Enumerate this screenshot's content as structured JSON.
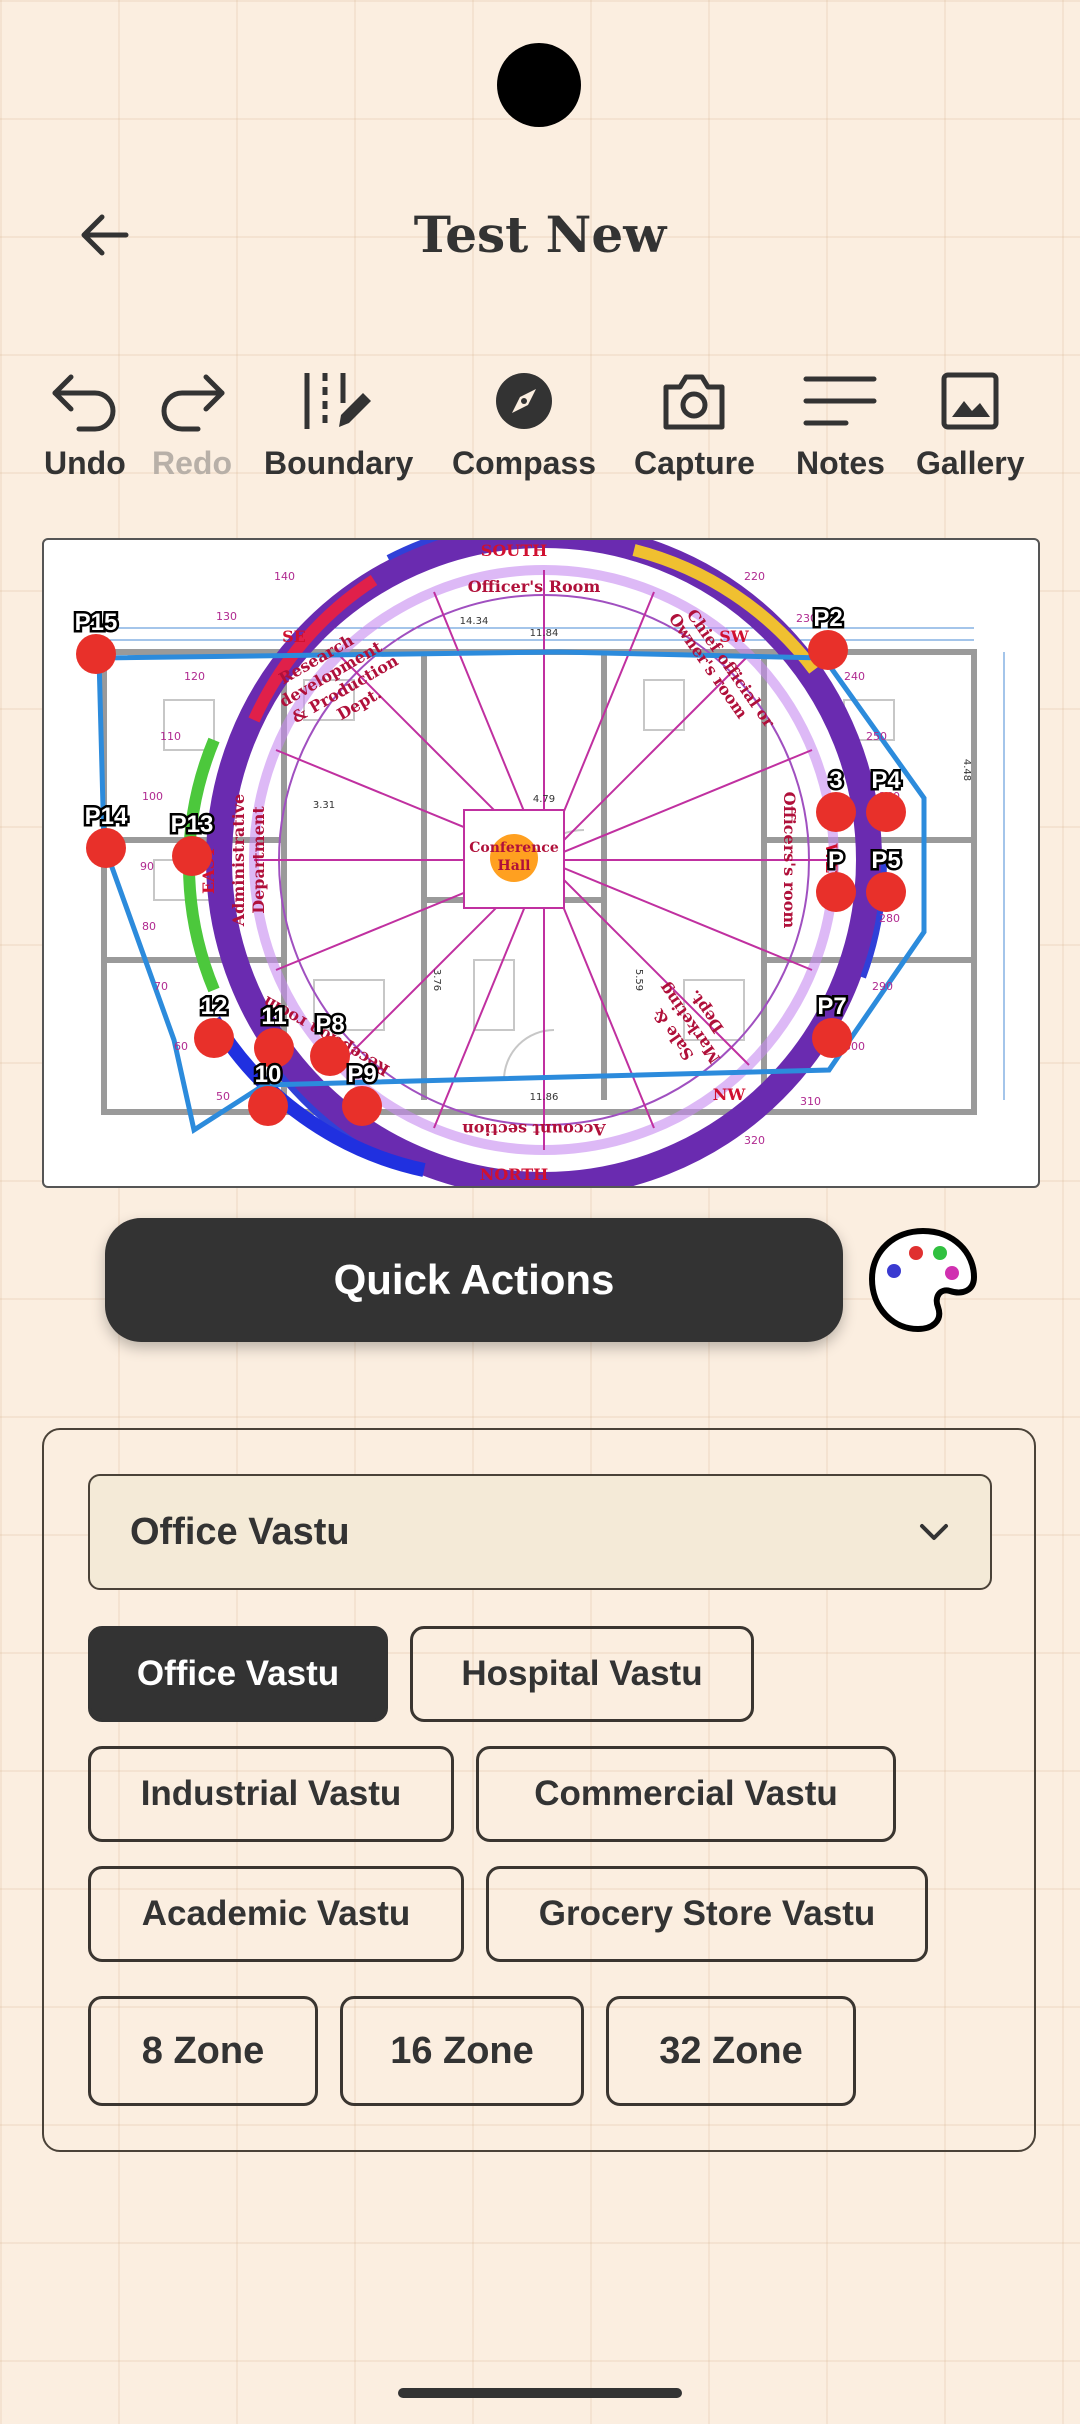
{
  "header": {
    "title": "Test New"
  },
  "toolbar": {
    "undo": "Undo",
    "redo": "Redo",
    "boundary": "Boundary",
    "compass": "Compass",
    "capture": "Capture",
    "notes": "Notes",
    "gallery": "Gallery"
  },
  "map": {
    "directions": {
      "south": "SOUTH",
      "north": "NORTH",
      "east": "EAST",
      "west": "WEST",
      "se": "SE",
      "sw": "SW",
      "nw": "NW"
    },
    "rooms": {
      "officers_room": "Officer's Room",
      "research": [
        "Research",
        "development",
        "& Production",
        "Dept."
      ],
      "chief": [
        "Chief official or",
        "Owner's room"
      ],
      "admin": [
        "Administrative",
        "Department"
      ],
      "conference": [
        "Conference",
        "Hall"
      ],
      "officers_room_w": "Officers's room",
      "reception": "Reception room",
      "sale": [
        "Sale &",
        "Marketing",
        "Dept."
      ],
      "account": "Account section"
    },
    "dims": {
      "d1": "14.34",
      "d2": "11.84",
      "d3": "3.31",
      "d4": "4.79",
      "d5": "11.86",
      "d6": "3.76",
      "d7": "5.59",
      "d8": "4.48"
    },
    "ring_ticks": [
      "140",
      "130",
      "120",
      "110",
      "100",
      "90",
      "80",
      "70",
      "60",
      "50",
      "220",
      "230",
      "240",
      "250",
      "260",
      "270",
      "280",
      "290",
      "300",
      "310",
      "320"
    ],
    "points": [
      "P15",
      "P2",
      "P14",
      "P13",
      "3",
      "P4",
      "P",
      "P5",
      "12",
      "11",
      "P8",
      "10",
      "P9",
      "P7"
    ]
  },
  "quick_actions": {
    "label": "Quick Actions"
  },
  "vastu": {
    "selected": "Office Vastu",
    "chips": [
      "Office Vastu",
      "Hospital Vastu",
      "Industrial Vastu",
      "Commercial Vastu",
      "Academic Vastu",
      "Grocery Store Vastu"
    ],
    "zones": [
      "8 Zone",
      "16 Zone",
      "32 Zone"
    ]
  },
  "colors": {
    "dark": "#333333",
    "point": "#e8302a",
    "boundary": "#2c8bdc",
    "ring": "#6a2bb0"
  }
}
